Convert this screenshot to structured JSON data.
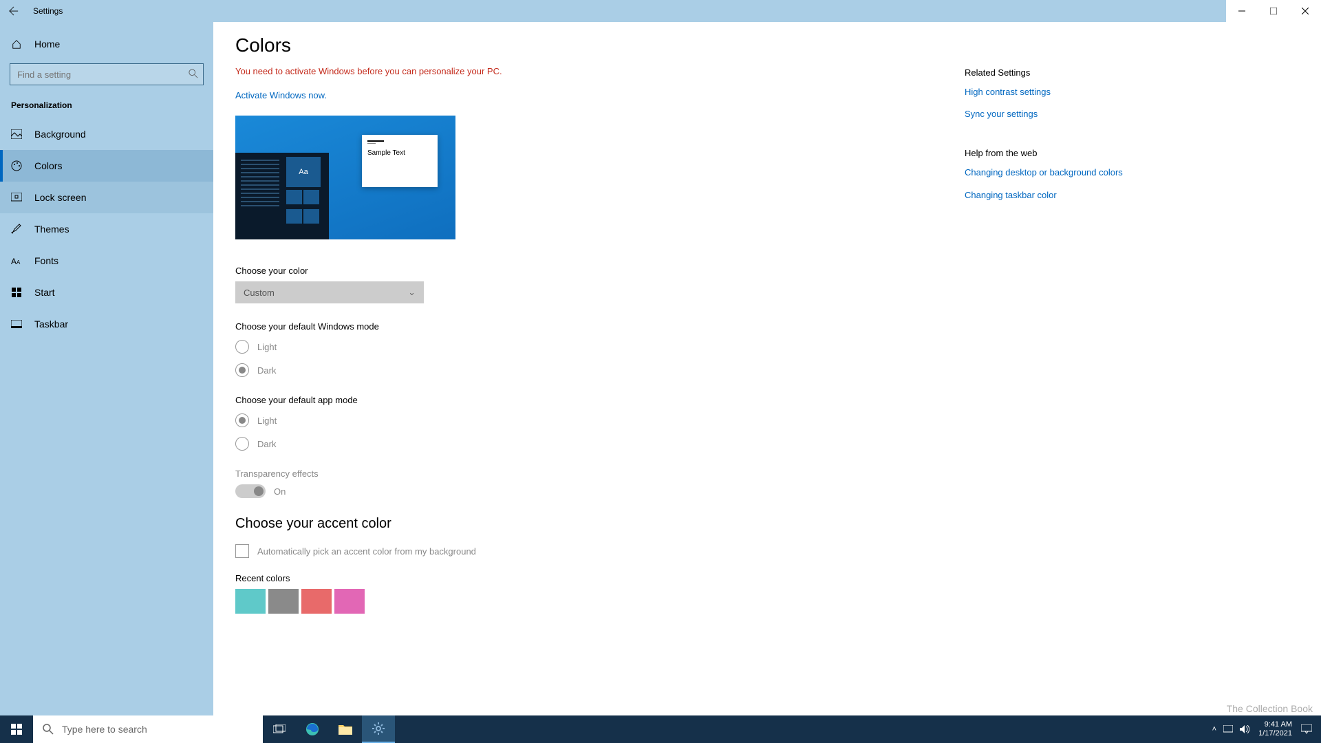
{
  "titlebar": {
    "title": "Settings"
  },
  "sidebar": {
    "home": "Home",
    "search_placeholder": "Find a setting",
    "category": "Personalization",
    "items": [
      {
        "label": "Background"
      },
      {
        "label": "Colors"
      },
      {
        "label": "Lock screen"
      },
      {
        "label": "Themes"
      },
      {
        "label": "Fonts"
      },
      {
        "label": "Start"
      },
      {
        "label": "Taskbar"
      }
    ]
  },
  "page": {
    "title": "Colors",
    "warning": "You need to activate Windows before you can personalize your PC.",
    "activate_link": "Activate Windows now.",
    "preview_sample": "Sample Text",
    "preview_aa": "Aa",
    "choose_color_label": "Choose your color",
    "choose_color_value": "Custom",
    "windows_mode_label": "Choose your default Windows mode",
    "windows_mode_light": "Light",
    "windows_mode_dark": "Dark",
    "app_mode_label": "Choose your default app mode",
    "app_mode_light": "Light",
    "app_mode_dark": "Dark",
    "transparency_label": "Transparency effects",
    "transparency_state": "On",
    "accent_title": "Choose your accent color",
    "auto_pick_label": "Automatically pick an accent color from my background",
    "recent_colors_label": "Recent colors",
    "recent_colors": [
      "#5fc9c9",
      "#8a8a8a",
      "#e86a6a",
      "#e267b5"
    ]
  },
  "right": {
    "related_head": "Related Settings",
    "related_links": [
      "High contrast settings",
      "Sync your settings"
    ],
    "help_head": "Help from the web",
    "help_links": [
      "Changing desktop or background colors",
      "Changing taskbar color"
    ]
  },
  "taskbar": {
    "search_placeholder": "Type here to search",
    "time": "9:41 AM",
    "date": "1/17/2021"
  },
  "watermark": "The Collection Book"
}
